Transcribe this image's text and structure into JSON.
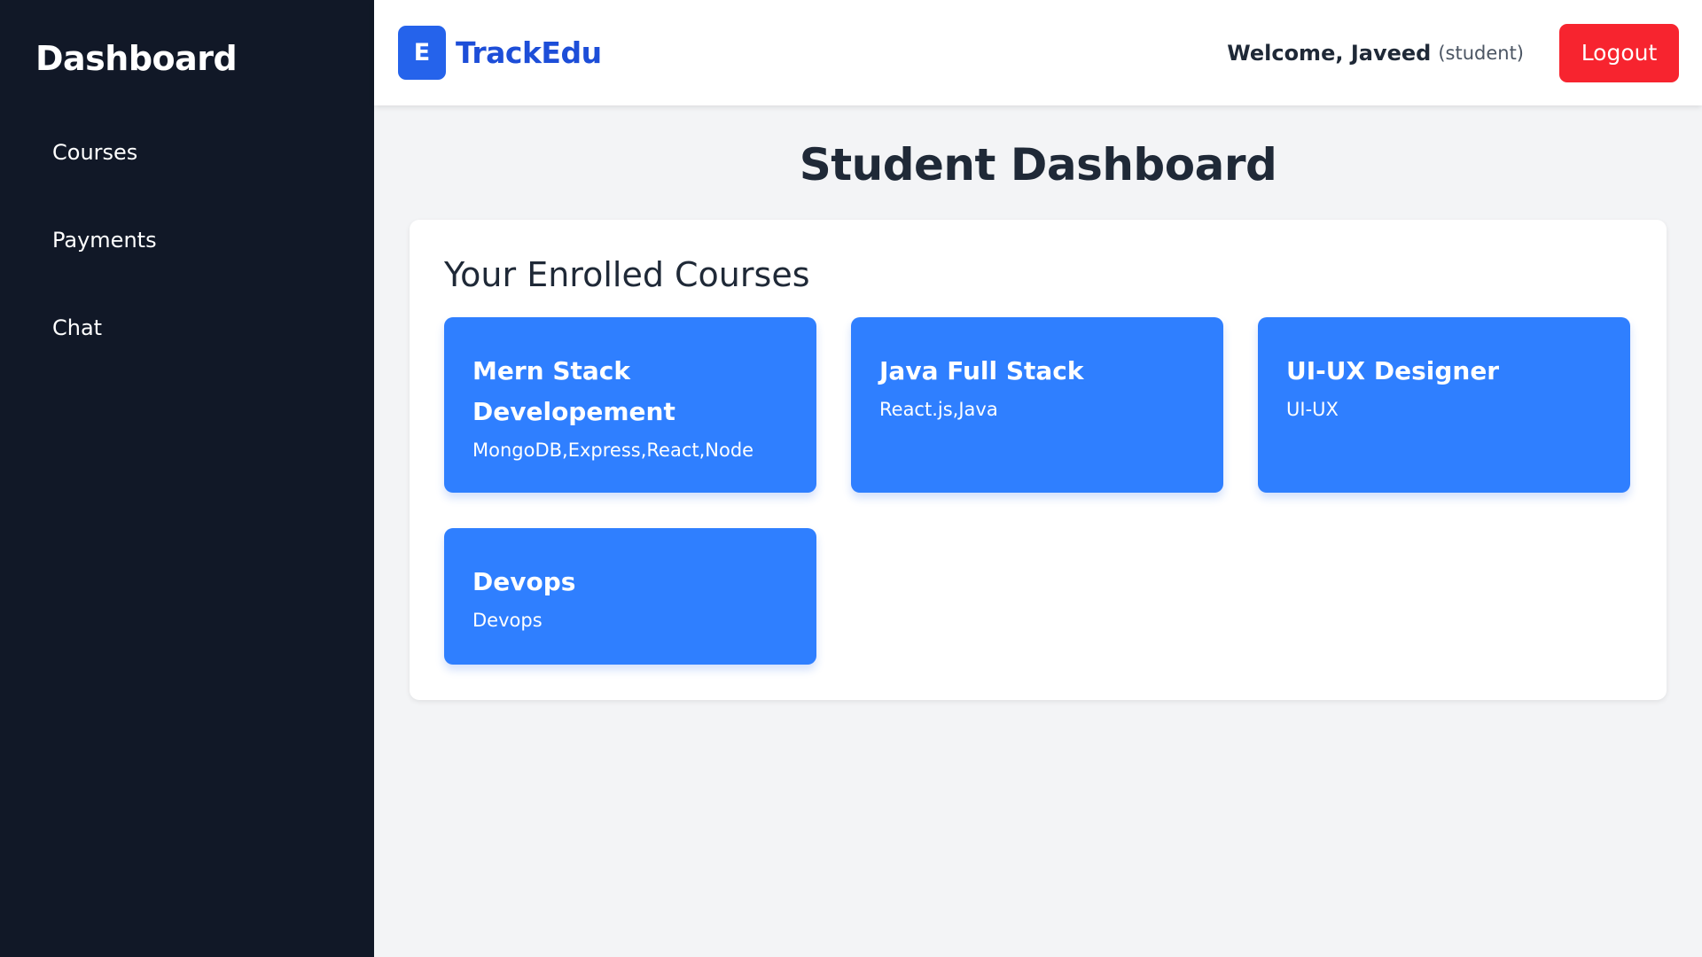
{
  "sidebar": {
    "title": "Dashboard",
    "items": [
      {
        "label": "Courses"
      },
      {
        "label": "Payments"
      },
      {
        "label": "Chat"
      }
    ]
  },
  "header": {
    "logo_letter": "E",
    "brand": "TrackEdu",
    "welcome": "Welcome, Javeed",
    "role": "(student)",
    "logout_label": "Logout"
  },
  "main": {
    "page_title": "Student Dashboard",
    "section_title": "Your Enrolled Courses",
    "courses": [
      {
        "title": "Mern Stack Developement",
        "tech": "MongoDB,Express,React,Node"
      },
      {
        "title": "Java Full Stack",
        "tech": "React.js,Java"
      },
      {
        "title": "UI-UX Designer",
        "tech": "UI-UX"
      },
      {
        "title": "Devops",
        "tech": "Devops"
      }
    ]
  },
  "colors": {
    "sidebar_bg": "#111827",
    "brand": "#1d4ed8",
    "card_bg": "#2f7fff",
    "logout_bg": "#f7242f"
  }
}
